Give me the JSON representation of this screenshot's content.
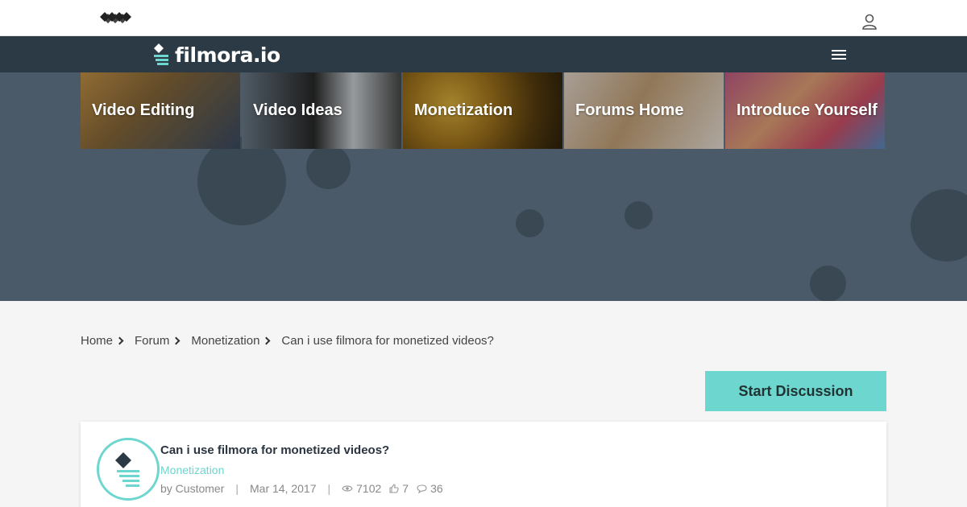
{
  "header": {
    "brand_name": "filmora.io",
    "brand_color": "#2b3a44",
    "accent_color": "#6cd6cf",
    "icons": [
      "wondershare-logo-icon",
      "user-icon",
      "menu-icon"
    ]
  },
  "categories": [
    {
      "label": "Video Editing"
    },
    {
      "label": "Video Ideas"
    },
    {
      "label": "Monetization"
    },
    {
      "label": "Forums Home"
    },
    {
      "label": "Introduce Yourself"
    }
  ],
  "breadcrumb": {
    "home": "Home",
    "forum": "Forum",
    "section": "Monetization",
    "current": "Can i use filmora for monetized videos?"
  },
  "actions": {
    "start_discussion": "Start Discussion"
  },
  "post": {
    "title": "Can i use filmora for monetized videos?",
    "category": "Monetization",
    "author": "by Customer",
    "separator": "|",
    "date": "Mar 14, 2017",
    "views": "7102",
    "likes": "7",
    "comments": "36"
  }
}
